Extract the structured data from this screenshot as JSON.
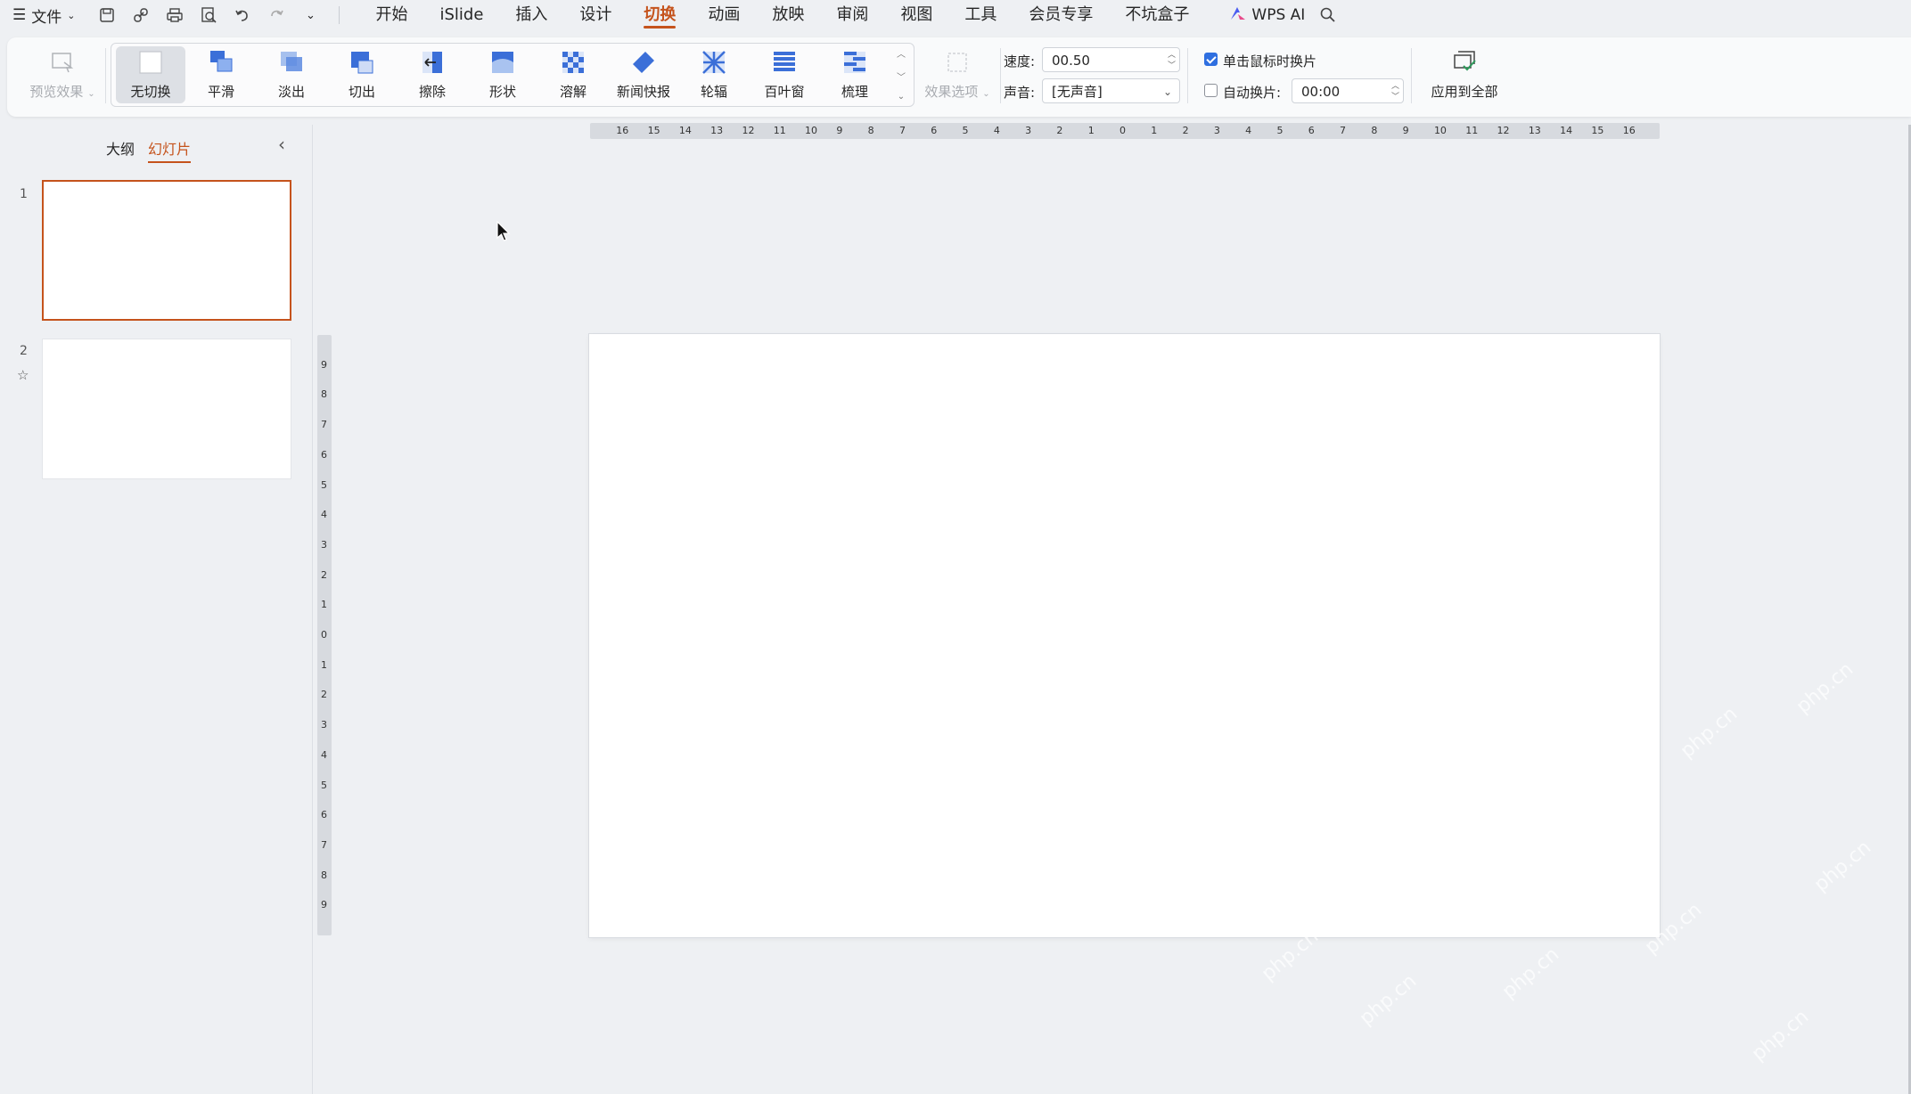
{
  "menubar": {
    "file_label": "文件",
    "tabs": [
      {
        "label": "开始",
        "active": false
      },
      {
        "label": "iSlide",
        "active": false
      },
      {
        "label": "插入",
        "active": false
      },
      {
        "label": "设计",
        "active": false
      },
      {
        "label": "切换",
        "active": true
      },
      {
        "label": "动画",
        "active": false
      },
      {
        "label": "放映",
        "active": false
      },
      {
        "label": "审阅",
        "active": false
      },
      {
        "label": "视图",
        "active": false
      },
      {
        "label": "工具",
        "active": false
      },
      {
        "label": "会员专享",
        "active": false
      },
      {
        "label": "不坑盒子",
        "active": false
      }
    ],
    "ai_label": "WPS AI"
  },
  "ribbon": {
    "preview_label": "预览效果",
    "transitions": [
      "无切换",
      "平滑",
      "淡出",
      "切出",
      "擦除",
      "形状",
      "溶解",
      "新闻快报",
      "轮辐",
      "百叶窗",
      "梳理"
    ],
    "effect_options_label": "效果选项",
    "speed_label": "速度:",
    "speed_value": "00.50",
    "sound_label": "声音:",
    "sound_value": "[无声音]",
    "on_click_label": "单击鼠标时换片",
    "on_click_checked": true,
    "auto_label": "自动换片:",
    "auto_checked": false,
    "auto_value": "00:00",
    "apply_all_label": "应用到全部"
  },
  "leftpanel": {
    "tab_outline": "大纲",
    "tab_slides": "幻灯片",
    "slides": [
      {
        "num": "1"
      },
      {
        "num": "2"
      }
    ]
  },
  "rulers": {
    "h_ticks": [
      "16",
      "15",
      "14",
      "13",
      "12",
      "11",
      "10",
      "9",
      "8",
      "7",
      "6",
      "5",
      "4",
      "3",
      "2",
      "1",
      "0",
      "1",
      "2",
      "3",
      "4",
      "5",
      "6",
      "7",
      "8",
      "9",
      "10",
      "11",
      "12",
      "13",
      "14",
      "15",
      "16"
    ],
    "v_ticks": [
      "9",
      "8",
      "7",
      "6",
      "5",
      "4",
      "3",
      "2",
      "1",
      "0",
      "1",
      "2",
      "3",
      "4",
      "5",
      "6",
      "7",
      "8",
      "9"
    ]
  },
  "watermark": "php.cn",
  "colors": {
    "accent": "#c5531c",
    "checkbox": "#2f6fe0"
  }
}
